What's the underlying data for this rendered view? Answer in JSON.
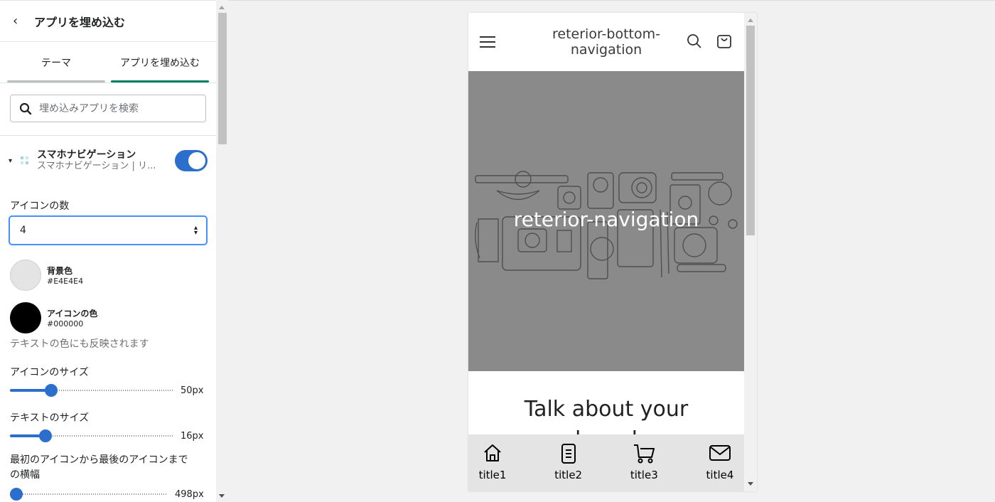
{
  "sidebar": {
    "header_title": "アプリを埋め込む",
    "tabs": [
      {
        "label": "テーマ"
      },
      {
        "label": "アプリを埋め込む"
      }
    ],
    "search_placeholder": "埋め込みアプリを検索",
    "app": {
      "name": "スマホナビゲーション",
      "subtitle": "スマホナビゲーション | リ...",
      "enabled": true
    },
    "icon_count_label": "アイコンの数",
    "icon_count_value": "4",
    "bg_color": {
      "label": "背景色",
      "hex": "#E4E4E4"
    },
    "icon_color": {
      "label": "アイコンの色",
      "hex": "#000000"
    },
    "icon_color_hint": "テキストの色にも反映されます",
    "icon_size": {
      "label": "アイコンのサイズ",
      "value": "50px",
      "fraction": 0.25
    },
    "text_size": {
      "label": "テキストのサイズ",
      "value": "16px",
      "fraction": 0.22
    },
    "width": {
      "label": "最初のアイコンから最後のアイコンまでの横幅",
      "value": "498px",
      "fraction": 0.04
    }
  },
  "preview": {
    "shop_title": "reterior-bottom-navigation",
    "hero_text": "reterior-navigation",
    "section_heading": "Talk about your",
    "nav_items": [
      {
        "label": "title1",
        "icon": "home-icon"
      },
      {
        "label": "title2",
        "icon": "document-icon"
      },
      {
        "label": "title3",
        "icon": "cart-icon"
      },
      {
        "label": "title4",
        "icon": "mail-icon"
      }
    ],
    "colors": {
      "accent": "#2c6ecb",
      "tab_active": "#008060",
      "nav_bg": "#E4E4E4"
    }
  }
}
